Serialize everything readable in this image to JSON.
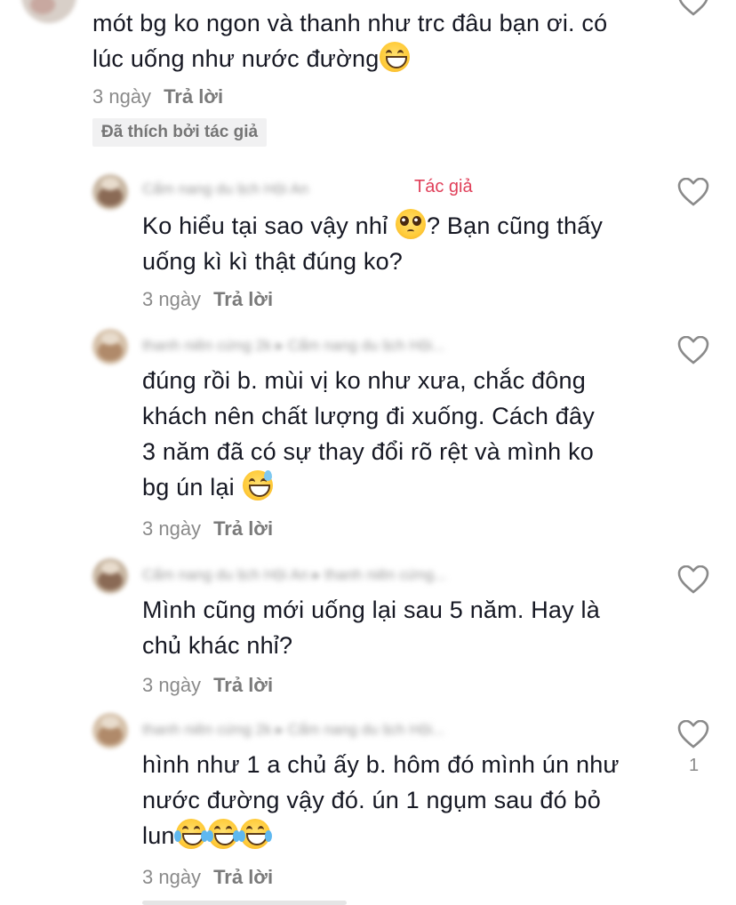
{
  "comments": [
    {
      "id": "c0",
      "text_1": "mót bg ko ngon và thanh như trc đâu bạn ơi. có",
      "text_2": "lúc uống như nước đường",
      "time": "3 ngày",
      "reply": "Trả lời",
      "badge": "Đã thích bởi tác giả",
      "emoji": "grinning-face-icon"
    },
    {
      "id": "c1",
      "name": "Cẩm nang du lịch Hội An",
      "author_tag": "Tác giả",
      "text_1a": "Ko hiểu tại sao vậy nhỉ ",
      "text_1b": "? Bạn cũng thấy",
      "text_2": "uống kì kì thật đúng ko?",
      "time": "3 ngày",
      "reply": "Trả lời",
      "emoji": "pleading-face-icon"
    },
    {
      "id": "c2",
      "name": "thanh niên cứng 2k ▸ Cẩm nang du lịch Hội...",
      "text_1": "đúng rồi b. mùi vị ko như xưa, chắc đông",
      "text_2": "khách nên chất lượng đi xuống. Cách đây",
      "text_3": "3 năm đã có sự thay đổi rõ rệt và mình ko",
      "text_4": "bg ún lại ",
      "time": "3 ngày",
      "reply": "Trả lời",
      "emoji": "sweat-smile-icon"
    },
    {
      "id": "c3",
      "name": "Cẩm nang du lịch Hội An ▸ thanh niên cứng...",
      "text_1": "Mình cũng mới uống lại sau 5 năm. Hay là",
      "text_2": "chủ khác nhỉ?",
      "time": "3 ngày",
      "reply": "Trả lời"
    },
    {
      "id": "c4",
      "name": "thanh niên cứng 2k ▸ Cẩm nang du lịch Hội...",
      "text_1": "hình như 1 a chủ ấy b. hôm đó mình ún như",
      "text_2": "nước đường vậy đó. ún 1 ngụm sau đó bỏ",
      "text_3": "lun",
      "time": "3 ngày",
      "reply": "Trả lời",
      "like_count": "1",
      "emoji": "joy-face-icon"
    }
  ],
  "colors": {
    "author_tag": "#e0405a",
    "text": "#161823",
    "meta": "#8a8a8a",
    "badge_bg": "#f1f1f2"
  }
}
